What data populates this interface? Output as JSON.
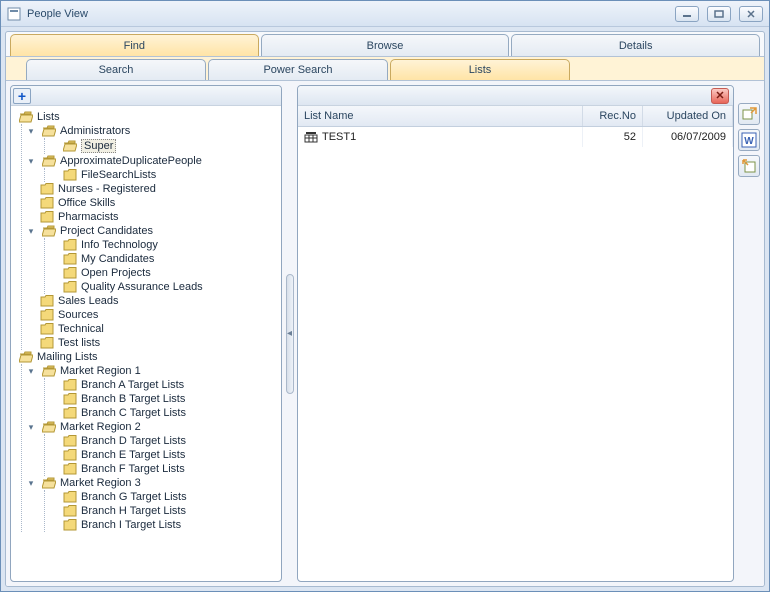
{
  "window": {
    "title": "People View"
  },
  "tabs_primary": [
    {
      "label": "Find",
      "active": true
    },
    {
      "label": "Browse",
      "active": false
    },
    {
      "label": "Details",
      "active": false
    }
  ],
  "tabs_secondary": [
    {
      "label": "Search",
      "active": false
    },
    {
      "label": "Power Search",
      "active": false
    },
    {
      "label": "Lists",
      "active": true
    }
  ],
  "tree": [
    {
      "label": "Lists",
      "expanded": true,
      "open": true,
      "children": [
        {
          "label": "Administrators",
          "expanded": true,
          "open": true,
          "children": [
            {
              "label": "Super",
              "selected": true,
              "open": true
            }
          ]
        },
        {
          "label": "ApproximateDuplicatePeople",
          "expanded": true,
          "open": true,
          "children": [
            {
              "label": "FileSearchLists"
            }
          ]
        },
        {
          "label": "Nurses - Registered"
        },
        {
          "label": "Office Skills"
        },
        {
          "label": "Pharmacists"
        },
        {
          "label": "Project Candidates",
          "expanded": true,
          "open": true,
          "children": [
            {
              "label": "Info Technology"
            },
            {
              "label": "My Candidates"
            },
            {
              "label": "Open Projects"
            },
            {
              "label": "Quality Assurance Leads"
            }
          ]
        },
        {
          "label": "Sales Leads"
        },
        {
          "label": "Sources"
        },
        {
          "label": "Technical"
        },
        {
          "label": "Test lists"
        }
      ]
    },
    {
      "label": "Mailing Lists",
      "expanded": true,
      "open": true,
      "children": [
        {
          "label": "Market Region 1",
          "expanded": true,
          "open": true,
          "children": [
            {
              "label": "Branch A Target Lists"
            },
            {
              "label": "Branch B Target Lists"
            },
            {
              "label": "Branch C Target Lists"
            }
          ]
        },
        {
          "label": "Market Region 2",
          "expanded": true,
          "open": true,
          "children": [
            {
              "label": "Branch D Target Lists"
            },
            {
              "label": "Branch E Target Lists"
            },
            {
              "label": "Branch F Target Lists"
            }
          ]
        },
        {
          "label": "Market Region 3",
          "expanded": true,
          "open": true,
          "children": [
            {
              "label": "Branch G Target Lists"
            },
            {
              "label": "Branch H Target Lists"
            },
            {
              "label": "Branch I Target Lists"
            }
          ]
        }
      ]
    }
  ],
  "grid": {
    "columns": [
      {
        "label": "List Name",
        "key": "name",
        "width": "auto"
      },
      {
        "label": "Rec.No",
        "key": "recno",
        "width": "60",
        "align": "right"
      },
      {
        "label": "Updated On",
        "key": "updated",
        "width": "90",
        "align": "right"
      }
    ],
    "rows": [
      {
        "name": "TEST1",
        "recno": "52",
        "updated": "06/07/2009"
      }
    ]
  }
}
